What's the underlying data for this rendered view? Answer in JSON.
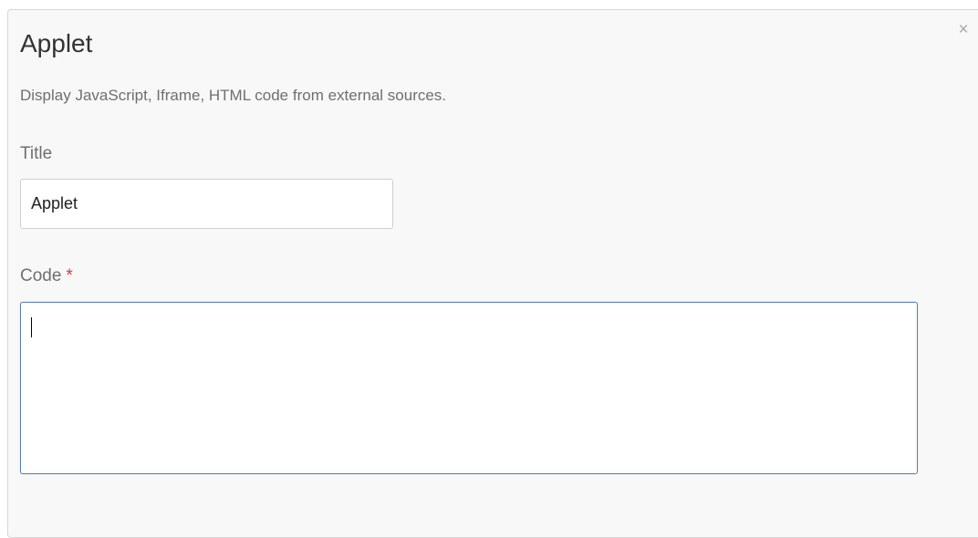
{
  "dialog": {
    "title": "Applet",
    "description": "Display JavaScript, Iframe, HTML code from external sources.",
    "close_glyph": "×"
  },
  "form": {
    "title_label": "Title",
    "title_value": "Applet",
    "code_label": "Code",
    "required_marker": "*",
    "code_value": ""
  },
  "colors": {
    "required": "#d83a3a",
    "focus_border": "#5a7fae"
  }
}
